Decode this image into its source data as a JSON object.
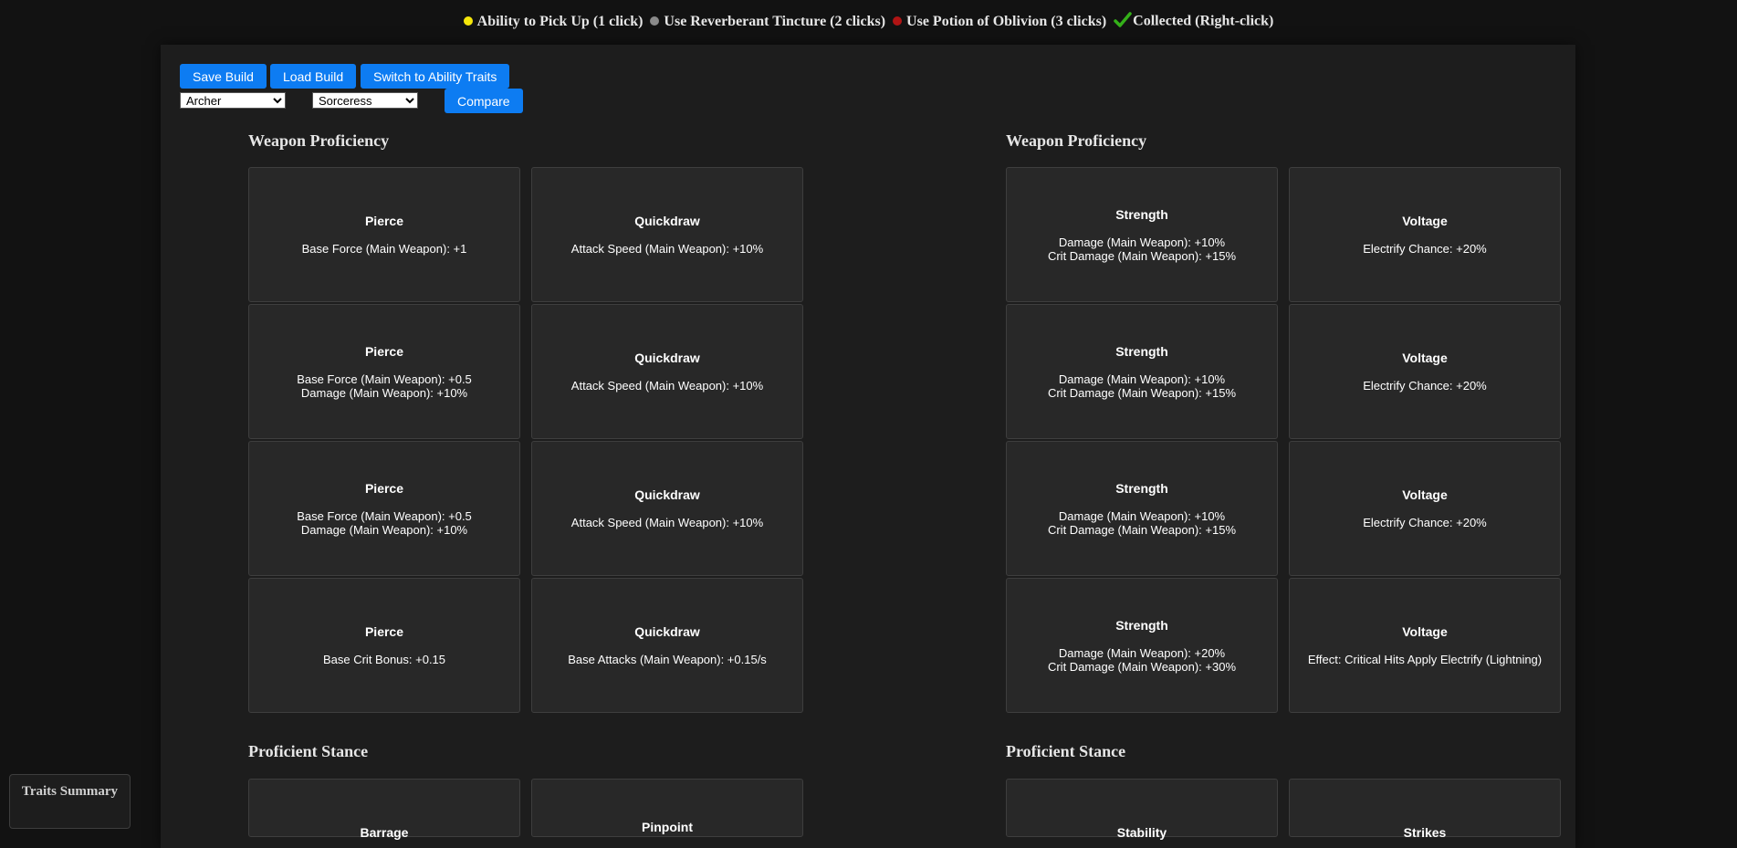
{
  "legend": [
    {
      "text": "Ability to Pick Up (1 click)",
      "color": "#f5e60a",
      "icon": "yellow-dot-icon"
    },
    {
      "text": "Use Reverberant Tincture (2 clicks)",
      "color": "#8a8a8a",
      "icon": "gray-dot-icon"
    },
    {
      "text": "Use Potion of Oblivion (3 clicks)",
      "color": "#b01414",
      "icon": "red-dot-icon"
    },
    {
      "text": "Collected (Right-click)",
      "color": "#34b019",
      "icon": "checkmark-icon"
    }
  ],
  "toolbar": {
    "save_label": "Save Build",
    "load_label": "Load Build",
    "switch_label": "Switch to Ability Traits",
    "compare_label": "Compare",
    "class_left": "Archer",
    "class_right": "Sorceress"
  },
  "left": {
    "section1_title": "Weapon Proficiency",
    "section2_title": "Proficient Stance",
    "cards": [
      {
        "name": "Pierce",
        "lines": [
          "Base Force (Main Weapon): +1"
        ]
      },
      {
        "name": "Quickdraw",
        "lines": [
          "Attack Speed (Main Weapon): +10%"
        ]
      },
      {
        "name": "Pierce",
        "lines": [
          "Base Force (Main Weapon): +0.5",
          "Damage (Main Weapon): +10%"
        ]
      },
      {
        "name": "Quickdraw",
        "lines": [
          "Attack Speed (Main Weapon): +10%"
        ]
      },
      {
        "name": "Pierce",
        "lines": [
          "Base Force (Main Weapon): +0.5",
          "Damage (Main Weapon): +10%"
        ]
      },
      {
        "name": "Quickdraw",
        "lines": [
          "Attack Speed (Main Weapon): +10%"
        ]
      },
      {
        "name": "Pierce",
        "lines": [
          "Base Crit Bonus: +0.15"
        ]
      },
      {
        "name": "Quickdraw",
        "lines": [
          "Base Attacks (Main Weapon): +0.15/s"
        ]
      }
    ],
    "stance_cards": [
      "Barrage",
      "Pinpoint"
    ]
  },
  "right": {
    "section1_title": "Weapon Proficiency",
    "section2_title": "Proficient Stance",
    "cards": [
      {
        "name": "Strength",
        "lines": [
          "Damage (Main Weapon): +10%",
          "Crit Damage (Main Weapon): +15%"
        ]
      },
      {
        "name": "Voltage",
        "lines": [
          "Electrify Chance: +20%"
        ]
      },
      {
        "name": "Strength",
        "lines": [
          "Damage (Main Weapon): +10%",
          "Crit Damage (Main Weapon): +15%"
        ]
      },
      {
        "name": "Voltage",
        "lines": [
          "Electrify Chance: +20%"
        ]
      },
      {
        "name": "Strength",
        "lines": [
          "Damage (Main Weapon): +10%",
          "Crit Damage (Main Weapon): +15%"
        ]
      },
      {
        "name": "Voltage",
        "lines": [
          "Electrify Chance: +20%"
        ]
      },
      {
        "name": "Strength",
        "lines": [
          "Damage (Main Weapon): +20%",
          "Crit Damage (Main Weapon): +30%"
        ]
      },
      {
        "name": "Voltage",
        "lines": [
          "Effect: Critical Hits Apply Electrify (Lightning)"
        ]
      }
    ],
    "stance_cards": [
      "Stability",
      "Strikes"
    ]
  },
  "summary_label": "Traits Summary"
}
